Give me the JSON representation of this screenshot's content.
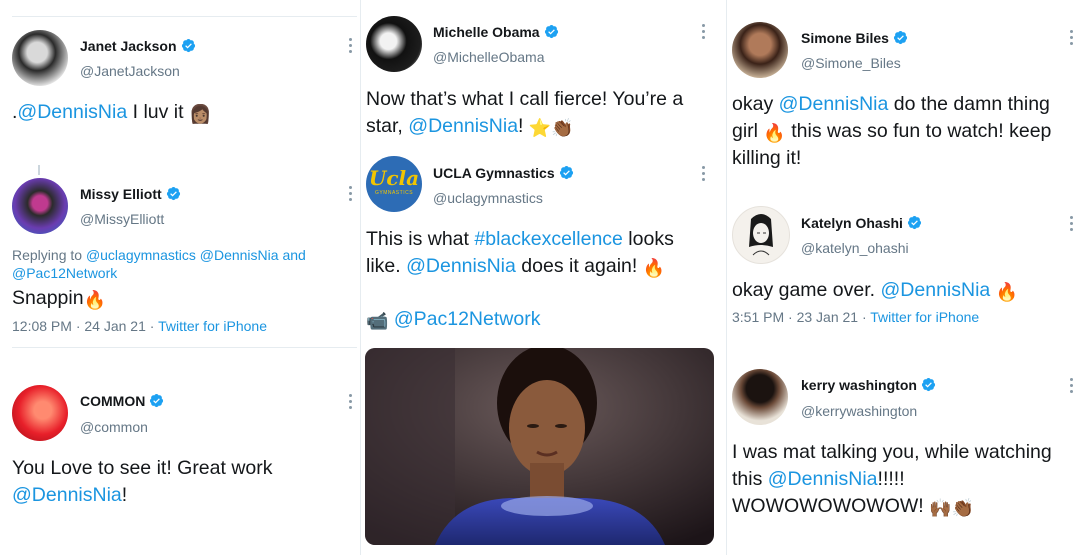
{
  "colors": {
    "link": "#1b95e0",
    "verified": "#1da1f2",
    "secondary": "#657786"
  },
  "col1": {
    "t1": {
      "name": "Janet Jackson",
      "handle": "@JanetJackson",
      "text_prefix": ".",
      "mention": "@DennisNia",
      "text_suffix": " I luv it ",
      "emoji": "👩🏽"
    },
    "t2": {
      "name": "Missy Elliott",
      "handle": "@MissyElliott",
      "reply_prefix": "Replying to ",
      "reply_m1": "@uclagymnastics",
      "reply_m2": "@DennisNia",
      "reply_and": " and ",
      "reply_m3": "@Pac12Network",
      "text": "Snappin",
      "emoji": "🔥",
      "time": "12:08 PM · 24 Jan 21 · ",
      "source": "Twitter for iPhone"
    },
    "t3": {
      "name": "COMMON",
      "handle": "@common",
      "text": "You Love to see it! Great work",
      "mention": "@DennisNia",
      "text_suffix": "!"
    }
  },
  "col2": {
    "t1": {
      "name": "Michelle Obama",
      "handle": "@MichelleObama",
      "text": "Now that’s what I call fierce! You’re a star, ",
      "mention": "@DennisNia",
      "text_suffix": "! ",
      "emoji": "⭐👏🏾"
    },
    "t2": {
      "name": "UCLA Gymnastics",
      "handle": "@uclagymnastics",
      "avatar_text": "Ucla",
      "avatar_sub": "GYMNASTICS",
      "text_prefix": "This is what ",
      "hashtag": "#blackexcellence",
      "text_mid": " looks like. ",
      "mention": "@DennisNia",
      "text_suffix": " does it again! ",
      "emoji": "🔥",
      "camera_emoji": "📹",
      "link_mention": "@Pac12Network"
    }
  },
  "col3": {
    "t1": {
      "name": "Simone Biles",
      "handle": "@Simone_Biles",
      "text_prefix": "okay ",
      "mention": "@DennisNia",
      "text_mid": " do the damn thing girl ",
      "emoji": "🔥",
      "text_suffix": " this was so fun to watch! keep killing it!"
    },
    "t2": {
      "name": "Katelyn Ohashi",
      "handle": "@katelyn_ohashi",
      "text_prefix": "okay game over. ",
      "mention": "@DennisNia",
      "emoji": "🔥",
      "time": "3:51 PM · 23 Jan 21 · ",
      "source": "Twitter for iPhone"
    },
    "t3": {
      "name": "kerry washington",
      "handle": "@kerrywashington",
      "text_prefix": "I was mat talking you, while watching this ",
      "mention": "@DennisNia",
      "text_suffix": "!!!!! WOWOWOWOWOW! ",
      "emoji": "🙌🏾👏🏾"
    }
  }
}
